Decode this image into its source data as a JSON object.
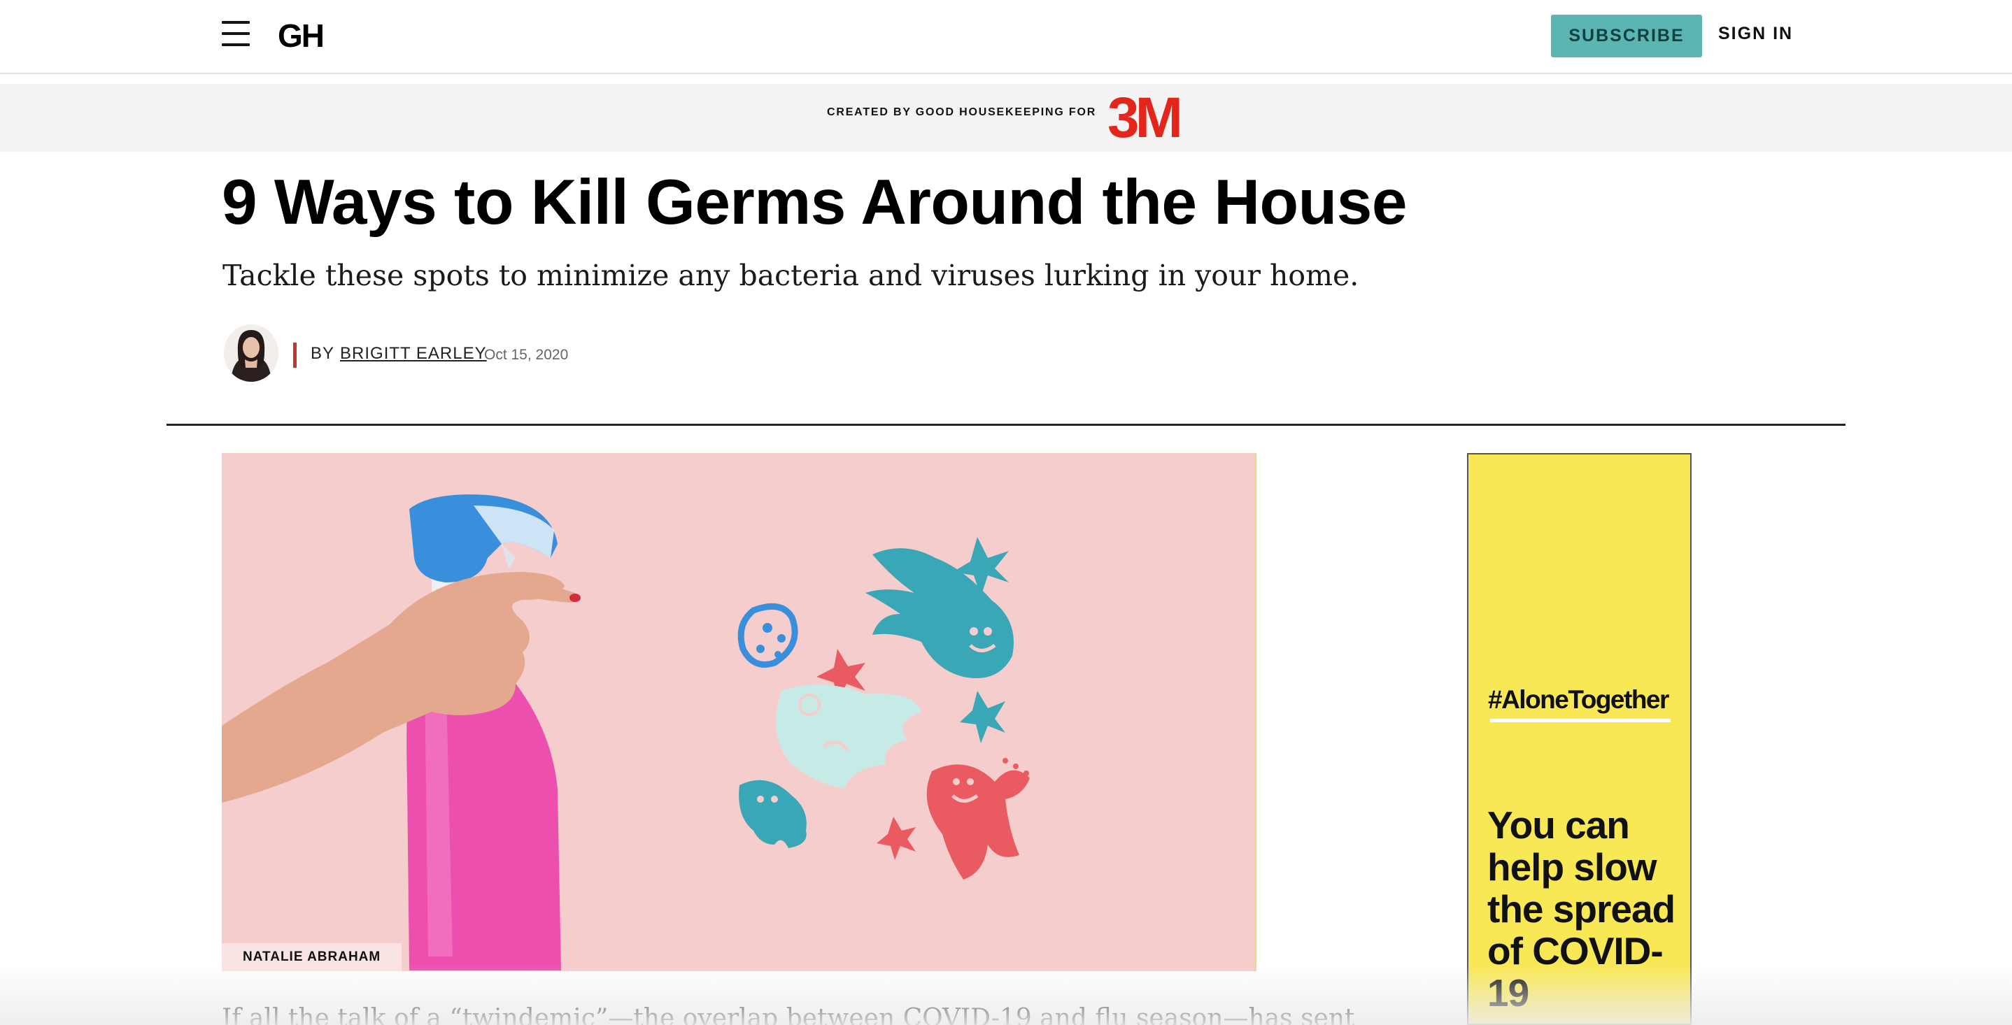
{
  "header": {
    "logo": "GH",
    "subscribe_label": "SUBSCRIBE",
    "signin_label": "SIGN IN"
  },
  "sponsor": {
    "text": "CREATED BY GOOD HOUSEKEEPING FOR",
    "brand": "3M"
  },
  "article": {
    "title": "9 Ways to Kill Germs Around the House",
    "dek": "Tackle these spots to minimize any bacteria and viruses lurking in your home.",
    "byline_prefix": "BY",
    "author": "BRIGITT EARLEY",
    "date": "Oct 15, 2020",
    "image_credit": "NATALIE ABRAHAM",
    "body_start": "If all the talk of a “twindemic”—the overlap between COVID-19 and flu season—has sent"
  },
  "ad": {
    "hashtag": "#AloneTogether",
    "headline": "You can help slow the spread of COVID-19"
  },
  "colors": {
    "subscribe_bg": "#5ab5b3",
    "brand_red": "#e3261c",
    "hero_bg": "#f6cdcd",
    "ad_bg": "#f9e856",
    "byline_bar": "#c0382b"
  }
}
